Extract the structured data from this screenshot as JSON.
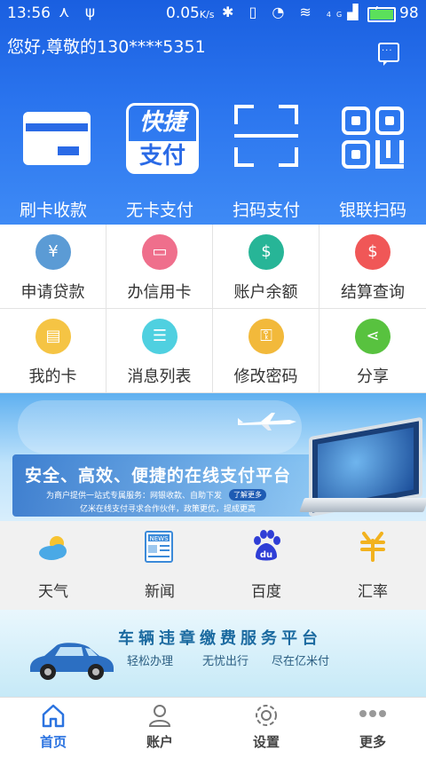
{
  "status": {
    "time": "13:56",
    "speed": "0.05",
    "speed_unit": "K/s",
    "network": "4G",
    "battery": "98"
  },
  "header": {
    "greeting": "您好,尊敬的130****5351"
  },
  "pay_methods": [
    {
      "label": "刷卡收款",
      "icon": "card-icon"
    },
    {
      "label": "无卡支付",
      "icon": "quick-pay-icon",
      "icon_text_top": "快捷",
      "icon_text_bottom": "支付"
    },
    {
      "label": "扫码支付",
      "icon": "scan-icon"
    },
    {
      "label": "银联扫码",
      "icon": "qr-code-icon"
    }
  ],
  "services": [
    {
      "label": "申请贷款",
      "icon": "loan-icon",
      "color": "#5b9bd5",
      "glyph": "¥"
    },
    {
      "label": "办信用卡",
      "icon": "credit-card-icon",
      "color": "#ef6f8c",
      "glyph": "▭"
    },
    {
      "label": "账户余额",
      "icon": "balance-icon",
      "color": "#27b597",
      "glyph": "$"
    },
    {
      "label": "结算查询",
      "icon": "settlement-icon",
      "color": "#f05757",
      "glyph": "$"
    },
    {
      "label": "我的卡",
      "icon": "my-card-icon",
      "color": "#f5c444",
      "glyph": "▤"
    },
    {
      "label": "消息列表",
      "icon": "message-list-icon",
      "color": "#4fd0e0",
      "glyph": "☰"
    },
    {
      "label": "修改密码",
      "icon": "lock-icon",
      "color": "#f2b93b",
      "glyph": "🔒"
    },
    {
      "label": "分享",
      "icon": "share-icon",
      "color": "#58c23f",
      "glyph": "<"
    }
  ],
  "banner1": {
    "title": "安全、高效、便捷的在线支付平台",
    "sub1": "为商户提供一站式专属服务：网银收款、自助下发",
    "sub2": "亿米在线支付寻求合作伙伴，政策更优，提成更高",
    "more": "了解更多"
  },
  "tools": [
    {
      "label": "天气",
      "icon": "weather-icon"
    },
    {
      "label": "新闻",
      "icon": "news-icon",
      "icon_text": "NEWS"
    },
    {
      "label": "百度",
      "icon": "baidu-icon",
      "icon_text": "du"
    },
    {
      "label": "汇率",
      "icon": "exchange-rate-icon"
    }
  ],
  "banner2": {
    "title": "车辆违章缴费服务平台",
    "s1": "轻松办理",
    "s2": "无忧出行",
    "s3": "尽在亿米付"
  },
  "tabs": [
    {
      "label": "首页",
      "icon": "home-icon",
      "active": true
    },
    {
      "label": "账户",
      "icon": "account-icon",
      "active": false
    },
    {
      "label": "设置",
      "icon": "settings-icon",
      "active": false
    },
    {
      "label": "更多",
      "icon": "more-icon",
      "active": false
    }
  ],
  "colors": {
    "accent": "#2b73e0",
    "hero": "#2a6ae6"
  }
}
